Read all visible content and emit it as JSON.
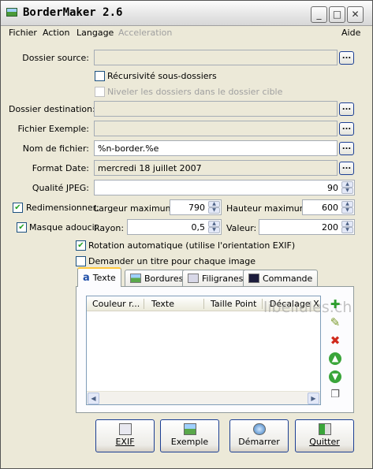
{
  "window": {
    "title": "BorderMaker 2.6",
    "controls": {
      "minimize": "_",
      "maximize": "□",
      "close": "✕"
    }
  },
  "menu": {
    "fichier": "Fichier",
    "action": "Action",
    "langage": "Langage",
    "acceleration": "Acceleration",
    "aide": "Aide"
  },
  "form": {
    "source_label": "Dossier source:",
    "source_value": "",
    "recurse_label": "Récursivité sous-dossiers",
    "level_label": "Niveler les dossiers dans le dossier cible",
    "dest_label": "Dossier destination:",
    "dest_value": "",
    "example_label": "Fichier Exemple:",
    "example_value": "",
    "filename_label": "Nom de fichier:",
    "filename_value": "%n-border.%e",
    "dateformat_label": "Format Date:",
    "dateformat_value": "mercredi 18 juillet 2007",
    "jpeg_label": "Qualité JPEG:",
    "jpeg_value": "90",
    "resize_label": "Redimensionner:",
    "maxwidth_label": "Largeur maximum:",
    "maxwidth_value": "790",
    "maxheight_label": "Hauteur maximum:",
    "maxheight_value": "600",
    "soften_label": "Masque adouci:",
    "radius_label": "Rayon:",
    "radius_value": "0,5",
    "value_label": "Valeur:",
    "value_value": "200",
    "rotation_label": "Rotation automatique (utilise l'orientation EXIF)",
    "asktitle_label": "Demander un titre pour chaque image",
    "browse": "..."
  },
  "tabs": {
    "texte": "Texte",
    "bordures": "Bordures",
    "filigranes": "Filigranes",
    "commande": "Commande"
  },
  "list": {
    "columns": [
      "Couleur r...",
      "Texte",
      "Taille Point",
      "Décalage X"
    ]
  },
  "buttons": {
    "exif": "EXIF",
    "exemple": "Exemple",
    "demarrer": "Démarrer",
    "quitter": "Quitter"
  },
  "watermark": "libellules.ch",
  "colors": {
    "check": "#21a121",
    "add": "#2e9e2e",
    "delete": "#d02a1c",
    "arrows": "#3aa53a",
    "tab_highlight": "#ffc83c"
  }
}
